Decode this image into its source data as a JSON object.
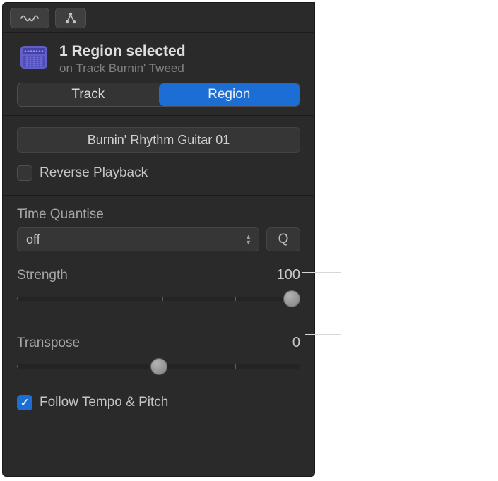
{
  "header": {
    "title": "1 Region selected",
    "subtitle": "on Track Burnin' Tweed"
  },
  "tabs": {
    "track": "Track",
    "region": "Region"
  },
  "region": {
    "name": "Burnin' Rhythm Guitar 01",
    "reverse_label": "Reverse Playback",
    "reverse_checked": false
  },
  "quantise": {
    "label": "Time Quantise",
    "value": "off",
    "q_button": "Q",
    "strength_label": "Strength",
    "strength_value": "100",
    "strength_pos_pct": 97
  },
  "transpose": {
    "label": "Transpose",
    "value": "0",
    "pos_pct": 50
  },
  "follow": {
    "label": "Follow Tempo & Pitch",
    "checked": true
  }
}
